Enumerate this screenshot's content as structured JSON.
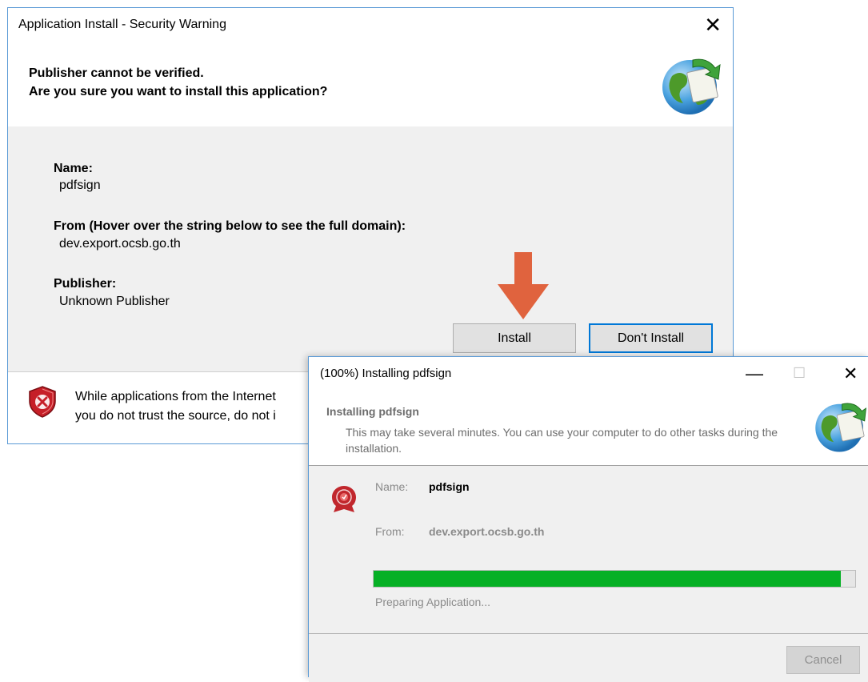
{
  "security_dialog": {
    "title": "Application Install - Security Warning",
    "close_icon": "close-icon",
    "heading_line1": "Publisher cannot be verified.",
    "heading_line2": "Are you sure you want to install this application?",
    "globe_icon": "application-install-globe-icon",
    "name_label": "Name:",
    "name_value": "pdfsign",
    "from_label": "From (Hover over the string below to see the full domain):",
    "from_value": "dev.export.ocsb.go.th",
    "publisher_label": "Publisher:",
    "publisher_value": "Unknown Publisher",
    "install_button": "Install",
    "dont_install_button": "Don't Install",
    "shield_icon": "security-shield-icon",
    "warning_line1": "While applications from the Internet",
    "warning_line2": "you do not trust the source, do not i",
    "arrow_color": "#e0633e"
  },
  "install_dialog": {
    "title": "(100%) Installing pdfsign",
    "heading": "Installing pdfsign",
    "description": "This may take several minutes. You can use your computer to do other tasks during the installation.",
    "name_label": "Name:",
    "name_value": "pdfsign",
    "from_label": "From:",
    "from_value": "dev.export.ocsb.go.th",
    "progress_percent": 97,
    "progress_color": "#06b025",
    "status": "Preparing Application...",
    "cancel_button": "Cancel"
  }
}
